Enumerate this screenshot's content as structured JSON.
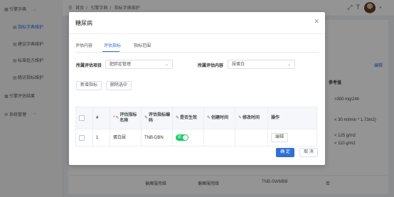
{
  "sidebar": {
    "items": [
      {
        "label": "引擎字典",
        "icon": "grid-icon"
      },
      {
        "label": "指标字典维护"
      },
      {
        "label": "建议字典维护"
      },
      {
        "label": "标准处方维护"
      },
      {
        "label": "随访指标维护"
      },
      {
        "label": "引擎评估结果",
        "icon": "grid-icon"
      },
      {
        "label": "系统管理",
        "icon": "gear-icon"
      }
    ]
  },
  "topbar": {
    "breadcrumb": [
      "首页",
      "引擎字典",
      "指标字典维护"
    ]
  },
  "background": {
    "right_header": "参考值",
    "right_link": "编辑",
    "right_values": [
      ">300 mg/24h",
      "< 30 ml/min * 1.73m2)",
      "< 125 g/m2",
      "< 110 g/m2"
    ],
    "bottom_row": [
      "偏瘫服用维",
      "偏瘫服用维",
      "TNB-SWMBB",
      "否"
    ]
  },
  "modal": {
    "title": "糖尿病",
    "tabs": [
      "评估内容",
      "评估指标",
      "指标范围"
    ],
    "active_tab": 1,
    "filters": {
      "project_label": "所属评估项目",
      "project_value": "肥胖症管理",
      "content_label": "所属评估内容",
      "content_value": "尿蛋白"
    },
    "actions": {
      "add": "新增指标",
      "delete": "删除选中"
    },
    "table": {
      "headers": {
        "index": "#",
        "name": "评估指标名称",
        "code": "评估指标编码",
        "effective": "是否生效",
        "created": "创建时间",
        "modified": "修改时间",
        "ops": "操作"
      },
      "rows": [
        {
          "index": "1",
          "name": "蛋白尿",
          "code": "TNB-DBN",
          "switch_text": "启",
          "created": "",
          "modified": "",
          "edit": "编辑"
        }
      ]
    },
    "footer": {
      "confirm": "确 定",
      "cancel": "取 消"
    }
  }
}
